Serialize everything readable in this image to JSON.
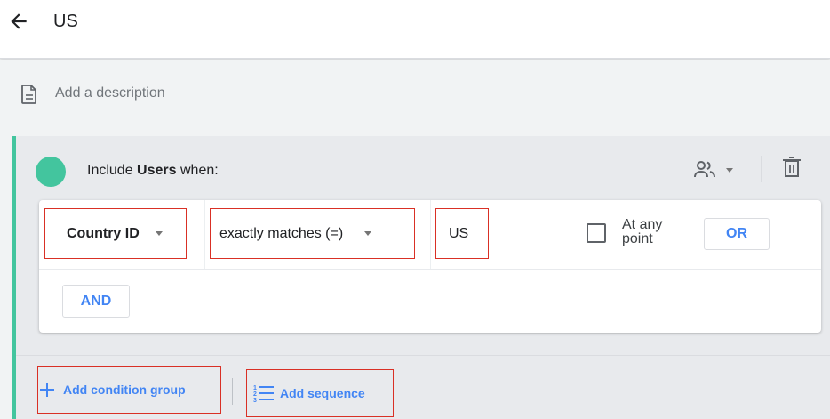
{
  "header": {
    "title": "US",
    "back_icon": "arrow-back-icon"
  },
  "description": {
    "placeholder": "Add a description",
    "icon": "document-icon"
  },
  "condition_group": {
    "accent_color": "#43c59e",
    "include_prefix": "Include",
    "include_entity": "Users",
    "include_suffix": "when:",
    "scope_icon": "people-icon",
    "delete_icon": "trash-icon",
    "condition": {
      "dimension": "Country ID",
      "operator": "exactly matches (=)",
      "value": "US",
      "at_any_point_label": "At any point",
      "at_any_point_checked": false,
      "or_label": "OR"
    },
    "and_label": "AND"
  },
  "footer": {
    "add_condition_group": "Add condition group",
    "add_sequence": "Add sequence",
    "add_icon": "plus-icon",
    "sequence_icon": "list-numbered-icon"
  },
  "colors": {
    "link_blue": "#4285f4",
    "highlight_red": "#d93025"
  }
}
